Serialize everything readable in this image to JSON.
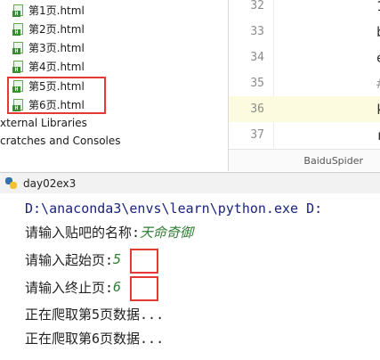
{
  "project_tree": {
    "files": [
      {
        "name": "第1页.html"
      },
      {
        "name": "第2页.html"
      },
      {
        "name": "第3页.html"
      },
      {
        "name": "第4页.html"
      },
      {
        "name": "第5页.html"
      },
      {
        "name": "第6页.html"
      }
    ],
    "file_icon_letter": "H",
    "nodes": [
      {
        "label": "xternal Libraries"
      },
      {
        "label": "cratches and Consoles"
      }
    ]
  },
  "editor": {
    "lines": [
      "32",
      "33",
      "34",
      "35",
      "36",
      "37"
    ],
    "current_line": "36",
    "code_fragments": [
      "1",
      "b",
      "e",
      "#",
      "k",
      "r"
    ],
    "breadcrumb": "BaiduSpider"
  },
  "run": {
    "config_name": "day02ex3",
    "console": {
      "command": "D:\\anaconda3\\envs\\learn\\python.exe D:",
      "prompt_name": "请输入贴吧的名称:",
      "input_name": "天命奇御",
      "prompt_start": "请输入起始页:",
      "input_start": "5",
      "prompt_end": "请输入终止页:",
      "input_end": "6",
      "output_1": "正在爬取第5页数据...",
      "output_2": "正在爬取第6页数据..."
    }
  },
  "colors": {
    "highlight": "#e53935",
    "current_line_bg": "#fcfadf",
    "user_input": "#2e7d32",
    "command_text": "#1a237e"
  }
}
